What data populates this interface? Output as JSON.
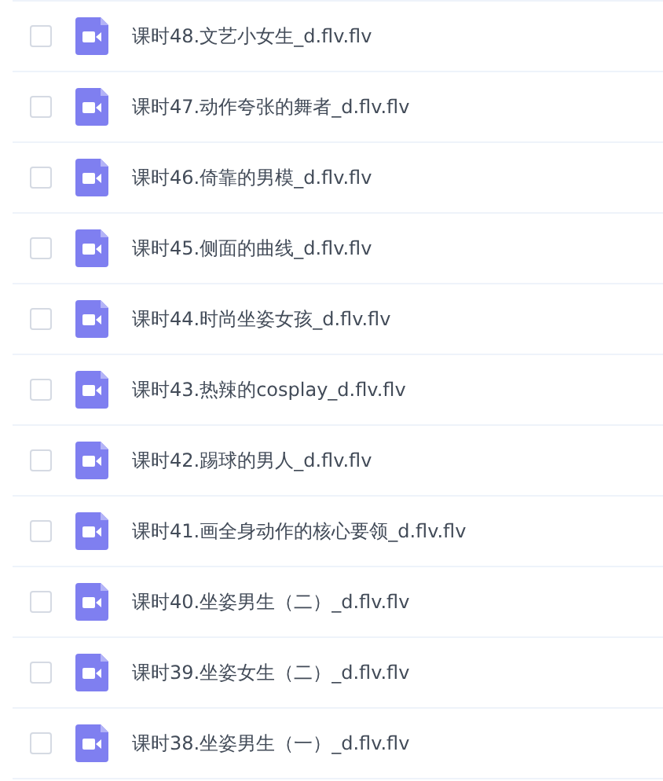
{
  "files": [
    {
      "name": "课时48.文艺小女生_d.flv.flv",
      "checked": false
    },
    {
      "name": "课时47.动作夸张的舞者_d.flv.flv",
      "checked": false
    },
    {
      "name": "课时46.倚靠的男模_d.flv.flv",
      "checked": false
    },
    {
      "name": "课时45.侧面的曲线_d.flv.flv",
      "checked": false
    },
    {
      "name": "课时44.时尚坐姿女孩_d.flv.flv",
      "checked": false
    },
    {
      "name": "课时43.热辣的cosplay_d.flv.flv",
      "checked": false
    },
    {
      "name": "课时42.踢球的男人_d.flv.flv",
      "checked": false
    },
    {
      "name": "课时41.画全身动作的核心要领_d.flv.flv",
      "checked": false
    },
    {
      "name": "课时40.坐姿男生（二）_d.flv.flv",
      "checked": false
    },
    {
      "name": "课时39.坐姿女生（二）_d.flv.flv",
      "checked": false
    },
    {
      "name": "课时38.坐姿男生（一）_d.flv.flv",
      "checked": false
    }
  ]
}
